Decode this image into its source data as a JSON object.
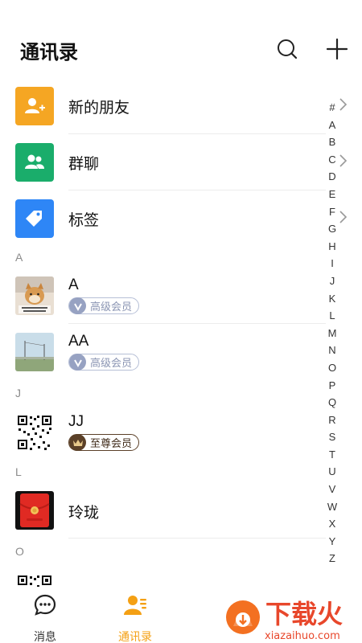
{
  "header": {
    "title": "通讯录"
  },
  "functions": [
    {
      "label": "新的朋友",
      "icon": "add-friend-icon",
      "color": "#f5a623"
    },
    {
      "label": "群聊",
      "icon": "group-icon",
      "color": "#1aad6b"
    },
    {
      "label": "标签",
      "icon": "tag-icon",
      "color": "#2e86f6"
    }
  ],
  "sections": [
    {
      "letter": "A",
      "contacts": [
        {
          "name": "A",
          "badge": "高级会员",
          "avatar": "shiba-dog-avatar"
        },
        {
          "name": "AA",
          "badge": "高级会员",
          "avatar": "landscape-avatar"
        }
      ]
    },
    {
      "letter": "J",
      "contacts": [
        {
          "name": "JJ",
          "badge": "至尊会员",
          "avatar": "qr-code-avatar"
        }
      ]
    },
    {
      "letter": "L",
      "contacts": [
        {
          "name": "玲珑",
          "avatar": "red-envelope-avatar"
        }
      ]
    },
    {
      "letter": "O",
      "contacts": [
        {
          "name": "",
          "avatar": "qr-code-avatar"
        }
      ]
    }
  ],
  "index": [
    "#",
    "A",
    "B",
    "C",
    "D",
    "E",
    "F",
    "G",
    "H",
    "I",
    "J",
    "K",
    "L",
    "M",
    "N",
    "O",
    "P",
    "Q",
    "R",
    "S",
    "T",
    "U",
    "V",
    "W",
    "X",
    "Y",
    "Z"
  ],
  "tabs": [
    {
      "label": "消息",
      "active": false
    },
    {
      "label": "通讯录",
      "active": true
    }
  ],
  "watermark": {
    "text": "下载火",
    "url": "xiazaihuo.com"
  },
  "colors": {
    "accent": "#f4a014",
    "vip": "#97a2c2",
    "svip": "#5b4028"
  }
}
